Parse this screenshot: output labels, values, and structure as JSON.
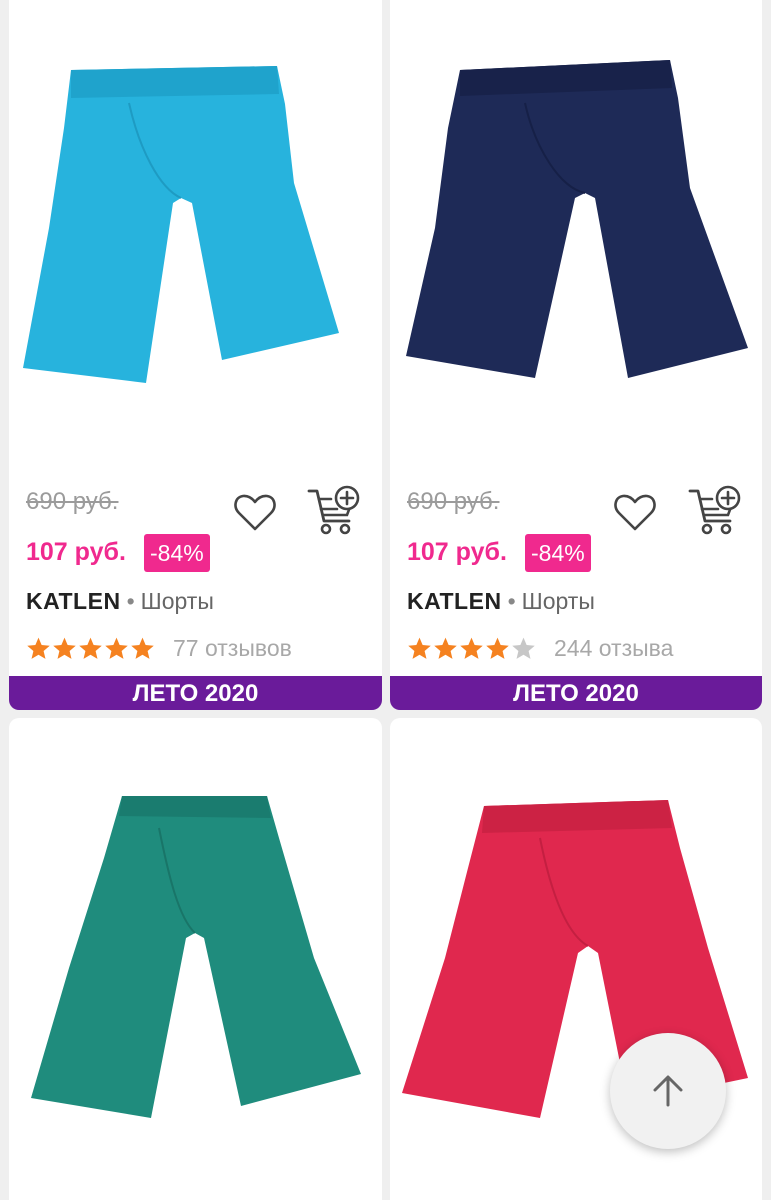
{
  "products": [
    {
      "old_price": "690 руб.",
      "new_price": "107 руб.",
      "discount": "-84%",
      "brand": "KATLEN",
      "category": "Шорты",
      "rating": 5,
      "reviews": "77 отзывов",
      "banner": "ЛЕТО 2020",
      "color": "#27b3dd"
    },
    {
      "old_price": "690 руб.",
      "new_price": "107 руб.",
      "discount": "-84%",
      "brand": "KATLEN",
      "category": "Шорты",
      "rating": 4,
      "reviews": "244 отзыва",
      "banner": "ЛЕТО 2020",
      "color": "#1e2a57"
    },
    {
      "color": "#1f8c7d"
    },
    {
      "color": "#e0284e"
    }
  ],
  "icons": {
    "favorite": "heart-icon",
    "cart": "add-to-cart-icon",
    "scroll_top": "arrow-up-icon"
  },
  "colors": {
    "accent": "#f0298e",
    "banner": "#6a1b9a",
    "star": "#f58220"
  }
}
